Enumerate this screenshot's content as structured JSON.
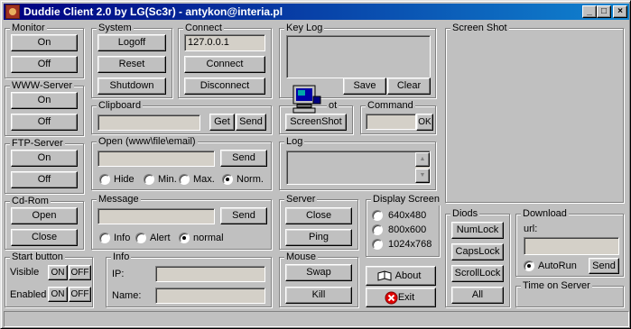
{
  "window": {
    "title": "Duddie Client 2.0 by LG(Sc3r) - antykon@interia.pl",
    "controls": {
      "minimize": "_",
      "maximize": "□",
      "close": "×"
    }
  },
  "monitor": {
    "title": "Monitor",
    "on": "On",
    "off": "Off"
  },
  "www_server": {
    "title": "WWW-Server",
    "on": "On",
    "off": "Off"
  },
  "ftp_server": {
    "title": "FTP-Server",
    "on": "On",
    "off": "Off"
  },
  "cdrom": {
    "title": "Cd-Rom",
    "open": "Open",
    "close": "Close"
  },
  "start_button": {
    "title": "Start button",
    "visible_label": "Visible",
    "enabled_label": "Enabled",
    "on": "ON",
    "off": "OFF"
  },
  "system": {
    "title": "System",
    "logoff": "Logoff",
    "reset": "Reset",
    "shutdown": "Shutdown"
  },
  "connect": {
    "title": "Connect",
    "ip_value": "127.0.0.1",
    "connect": "Connect",
    "disconnect": "Disconnect"
  },
  "clipboard": {
    "title": "Clipboard",
    "value": "",
    "get": "Get",
    "send": "Send"
  },
  "open": {
    "title": "Open (www\\file\\email)",
    "value": "",
    "send": "Send",
    "options": [
      "Hide",
      "Min.",
      "Max.",
      "Norm."
    ],
    "selected": "Norm."
  },
  "message": {
    "title": "Message",
    "value": "",
    "send": "Send",
    "options": [
      "Info",
      "Alert",
      "normal"
    ],
    "selected": "normal"
  },
  "info": {
    "title": "Info",
    "ip_label": "IP:",
    "name_label": "Name:",
    "ip_value": "",
    "name_value": ""
  },
  "keylog": {
    "title": "Key Log",
    "save": "Save",
    "clear": "Clear"
  },
  "screenshot_group": {
    "title_partial": "ot",
    "button": "ScreenShot"
  },
  "command": {
    "title": "Command",
    "value": "",
    "ok": "OK"
  },
  "log": {
    "title": "Log",
    "scroll_up": "▲",
    "scroll_down": "▼"
  },
  "server": {
    "title": "Server",
    "close": "Close",
    "ping": "Ping"
  },
  "mouse": {
    "title": "Mouse",
    "swap": "Swap",
    "kill": "Kill"
  },
  "display_screen": {
    "title": "Display Screen",
    "options": [
      "640x480",
      "800x600",
      "1024x768"
    ],
    "selected": ""
  },
  "about_button": "About",
  "exit_button": "Exit",
  "screen_shot_panel": {
    "title": "Screen Shot"
  },
  "diods": {
    "title": "Diods",
    "numlock": "NumLock",
    "capslock": "CapsLock",
    "scrolllock": "ScrollLock",
    "all": "All"
  },
  "download": {
    "title": "Download",
    "url_label": "url:",
    "url_value": "",
    "autorun": "AutoRun",
    "send": "Send"
  },
  "time_on_server": {
    "title": "Time on Server"
  },
  "status_bar": {
    "text": ""
  },
  "colors": {
    "face": "#c0c0c0",
    "title_start": "#000080",
    "title_end": "#1084d0",
    "exit_icon": "#e00000"
  }
}
